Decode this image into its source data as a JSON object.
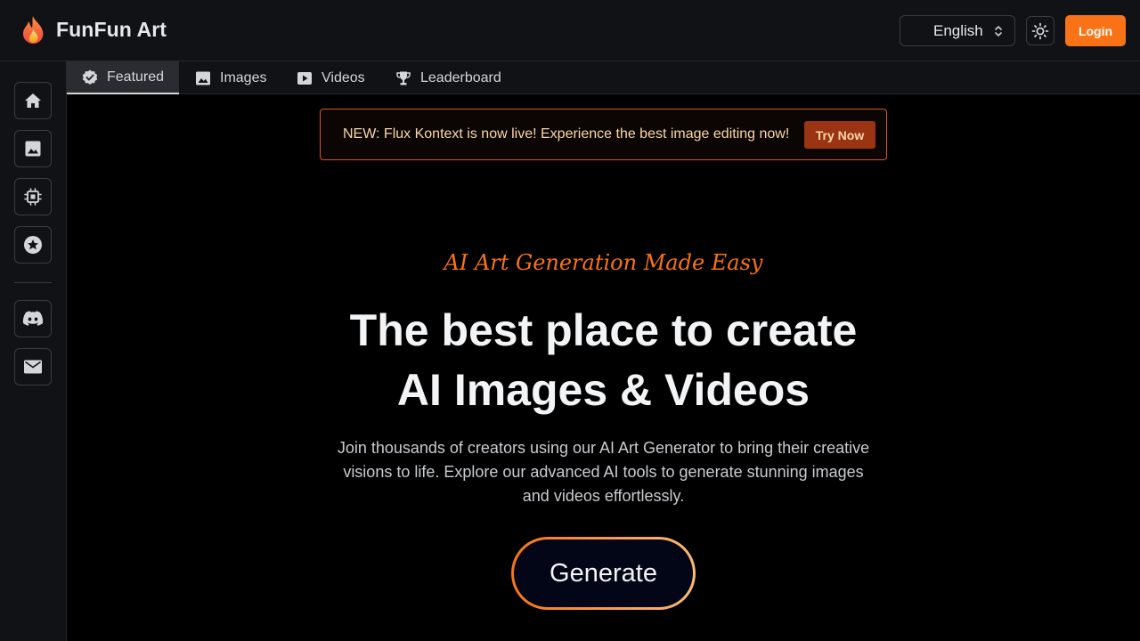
{
  "header": {
    "brand_name": "FunFun Art",
    "language": "English",
    "login_label": "Login"
  },
  "sidebar": {
    "items": [
      {
        "name": "home-icon"
      },
      {
        "name": "image-icon"
      },
      {
        "name": "chip-icon"
      },
      {
        "name": "star-icon"
      },
      {
        "name": "discord-icon"
      },
      {
        "name": "mail-icon"
      }
    ]
  },
  "tabs": [
    {
      "label": "Featured",
      "icon": "verified-badge-icon",
      "active": true
    },
    {
      "label": "Images",
      "icon": "image-icon",
      "active": false
    },
    {
      "label": "Videos",
      "icon": "video-icon",
      "active": false
    },
    {
      "label": "Leaderboard",
      "icon": "trophy-icon",
      "active": false
    }
  ],
  "banner": {
    "text": "NEW: Flux Kontext is now live! Experience the best image editing now!",
    "button_label": "Try Now"
  },
  "hero": {
    "tagline": "AI Art Generation Made Easy",
    "title_line1": "The best place to create",
    "title_line2": "AI Images & Videos",
    "description": "Join thousands of creators using our AI Art Generator to bring their creative visions to life. Explore our advanced AI tools to generate stunning images and videos effortlessly.",
    "generate_label": "Generate"
  },
  "colors": {
    "accent": "#f97316",
    "background": "#000000",
    "panel": "#111215"
  }
}
